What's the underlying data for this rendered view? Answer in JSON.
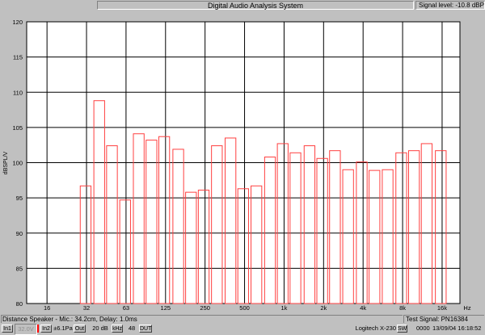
{
  "window": {
    "title": "Digital Audio Analysis System",
    "signal_level": "Signal level: -10.8 dBPa"
  },
  "colors": {
    "plot_bg": "#ffffff",
    "bars": "#ff4040",
    "grid": "#000000",
    "window_bg": "#c0c0c0"
  },
  "status": {
    "distance": "Distance Speaker - Mic.: 34.2cm, Delay: 1.0ms",
    "test_signal": "Test Signal: PN16384"
  },
  "toolbar": {
    "in1": "In1",
    "voltage": "32.0V",
    "in2": "In2",
    "pressure": "±6.1Pa",
    "out": "Out",
    "db": "20 dB",
    "khz": "kHz",
    "n48": "48",
    "dut": "DUT",
    "device": "Logitech X-230",
    "sw": "SW",
    "counter": "0000",
    "datetime": "13/09/04  16:18:52"
  },
  "chart_data": {
    "type": "bar",
    "title": "",
    "xlabel": "Hz",
    "ylabel": "dBSPL/V",
    "ylim": [
      80,
      120
    ],
    "yticks": [
      80,
      85,
      90,
      95,
      100,
      105,
      110,
      115,
      120
    ],
    "xtick_labels": [
      "16",
      "32",
      "63",
      "125",
      "250",
      "500",
      "1k",
      "2k",
      "4k",
      "8k",
      "16k"
    ],
    "bands_hz": [
      31.5,
      40,
      50,
      63,
      80,
      100,
      125,
      160,
      200,
      250,
      315,
      400,
      500,
      630,
      800,
      1000,
      1250,
      1600,
      2000,
      2500,
      3150,
      4000,
      5000,
      6300,
      8000,
      10000,
      12500,
      16000
    ],
    "values": [
      96.7,
      108.8,
      102.4,
      94.7,
      104.1,
      103.2,
      103.7,
      101.9,
      95.8,
      96.1,
      102.4,
      103.5,
      96.3,
      96.7,
      100.8,
      102.7,
      101.4,
      102.4,
      100.6,
      101.7,
      99.0,
      100.1,
      98.9,
      99.0,
      101.4,
      101.7,
      102.7,
      101.7
    ]
  }
}
